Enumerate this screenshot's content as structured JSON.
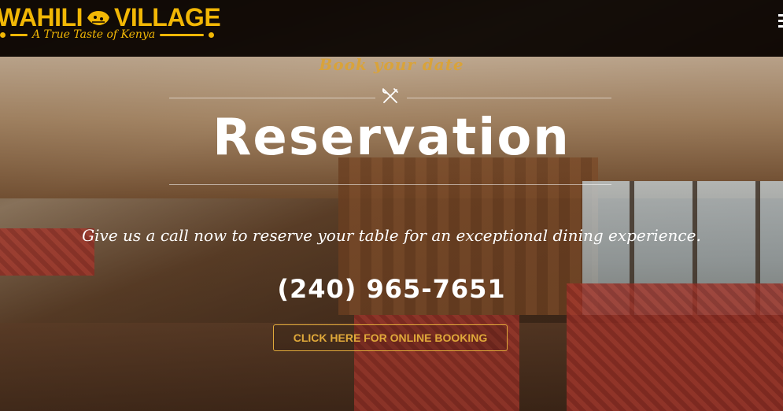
{
  "header": {
    "logo": {
      "title_left": "WAHILI",
      "title_right": "VILLAGE",
      "tagline": "A True Taste of Kenya",
      "emblem_icon": "kenya-map-emblem-icon"
    },
    "menu_icon": "hamburger-menu-icon"
  },
  "hero": {
    "subtitle": "Book your date",
    "divider_icon": "fork-knife-icon",
    "title": "Reservation",
    "description": "Give us a call now to reserve your table for an exceptional dining experience.",
    "phone": "(240) 965-7651",
    "booking_button_label": "CLICK HERE FOR ONLINE BOOKING"
  },
  "colors": {
    "brand_gold": "#f2b705",
    "accent_gold": "#d9a33a",
    "header_bg": "#0c0603",
    "text_white": "#ffffff"
  }
}
